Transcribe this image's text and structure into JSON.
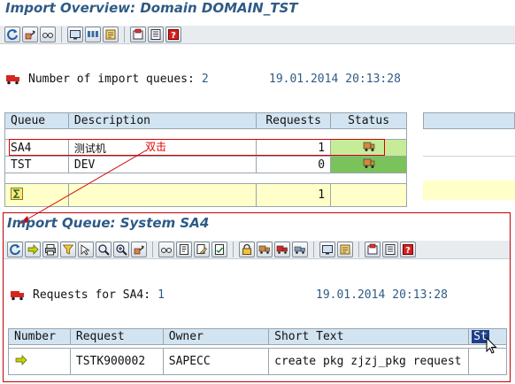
{
  "window": {
    "title": "Import Overview: Domain DOMAIN_TST"
  },
  "overview": {
    "queue_count_label": "Number of import queues:",
    "queue_count": "2",
    "date": "19.01.2014",
    "time": "20:13:28",
    "columns": [
      "Queue",
      "Description",
      "Requests",
      "Status"
    ],
    "rows": [
      {
        "queue": "SA4",
        "description": "测试机",
        "requests": "1",
        "status_icon": "truck-loaded-icon",
        "status_color": "#c6ec98"
      },
      {
        "queue": "TST",
        "description": "DEV",
        "requests": "0",
        "status_icon": "truck-loaded-icon",
        "status_color": "#7ac35a"
      }
    ],
    "total_icon": "sum-icon",
    "total": "1",
    "annotation": "双击"
  },
  "queue_view": {
    "title": "Import Queue: System SA4",
    "requests_label": "Requests for SA4:",
    "requests_count": "1",
    "date": "19.01.2014",
    "time": "20:13:28",
    "columns": [
      "Number",
      "Request",
      "Owner",
      "Short Text",
      "St"
    ],
    "rows": [
      {
        "number_icon": "green-arrow-icon",
        "request": "TSTK900002",
        "owner": "SAPECC",
        "short_text": "create pkg zjzj_pkg request"
      }
    ]
  },
  "colors": {
    "title": "#2e5b86",
    "header_bg": "#d2e4f2",
    "yellow_row": "#ffffc9",
    "highlight_red": "#d40000"
  }
}
